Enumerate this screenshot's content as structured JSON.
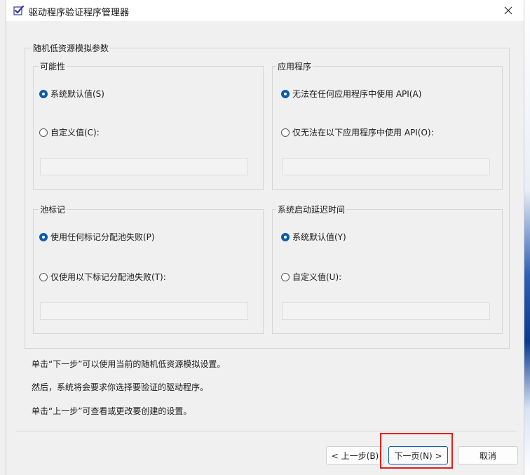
{
  "window": {
    "title": "驱动程序验证程序管理器",
    "close_label": "×"
  },
  "outer_group": {
    "title": "随机低资源模拟参数"
  },
  "groups": {
    "possibility": {
      "title": "可能性",
      "option_default": "系统默认值(S)",
      "option_custom": "自定义值(C):",
      "field_value": ""
    },
    "application": {
      "title": "应用程序",
      "option_any": "无法在任何应用程序中使用 API(A)",
      "option_only": "仅无法在以下应用程序中使用 API(O):",
      "field_value": ""
    },
    "pool_tag": {
      "title": "池标记",
      "option_any": "使用任何标记分配池失败(P)",
      "option_only": "仅使用以下标记分配池失败(T):",
      "field_value": ""
    },
    "startup_delay": {
      "title": "系统启动延迟时间",
      "option_default": "系统默认值(Y)",
      "option_custom": "自定义值(U):",
      "field_value": ""
    }
  },
  "info": {
    "line1": "单击“下一步”可以使用当前的随机低资源模拟设置。",
    "line2": "然后，系统将会要求你选择要验证的驱动程序。",
    "line3": "单击“上一步”可查看或更改要创建的设置。"
  },
  "buttons": {
    "back": "< 上一步(B)",
    "next": "下一页(N) >",
    "cancel": "取消"
  },
  "colors": {
    "accent": "#0b5cad",
    "highlight": "#e02020"
  }
}
